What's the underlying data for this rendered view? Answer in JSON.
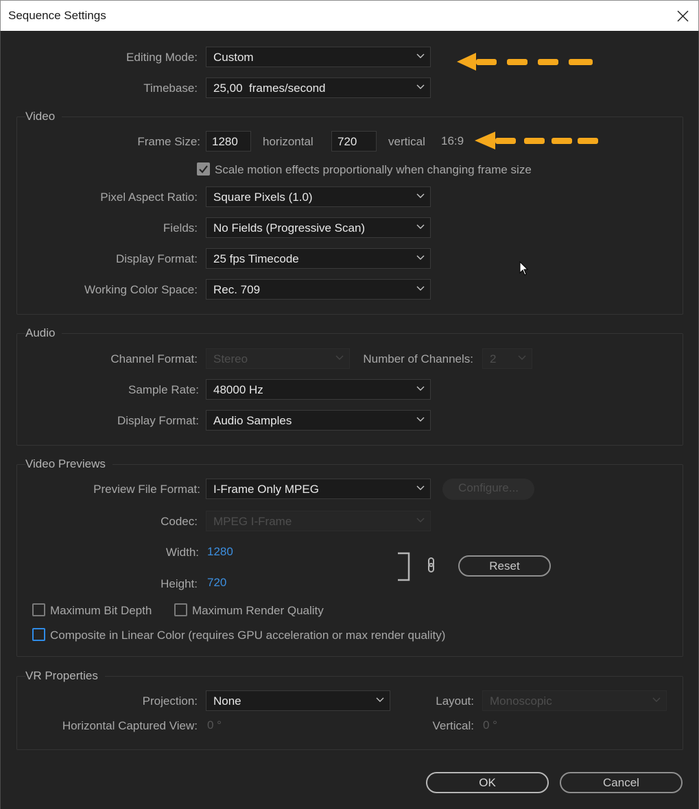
{
  "window": {
    "title": "Sequence Settings"
  },
  "general": {
    "editing_mode": {
      "label": "Editing Mode:",
      "value": "Custom"
    },
    "timebase": {
      "label": "Timebase:",
      "value": "25,00  frames/second"
    }
  },
  "video": {
    "title": "Video",
    "frame_size": {
      "label": "Frame Size:",
      "width": "1280",
      "horizontal_label": "horizontal",
      "height": "720",
      "vertical_label": "vertical",
      "aspect": "16:9"
    },
    "scale_motion": {
      "label": "Scale motion effects proportionally when changing frame size",
      "checked": true
    },
    "pixel_aspect_ratio": {
      "label": "Pixel Aspect Ratio:",
      "value": "Square Pixels (1.0)"
    },
    "fields": {
      "label": "Fields:",
      "value": "No Fields (Progressive Scan)"
    },
    "display_format": {
      "label": "Display Format:",
      "value": "25 fps Timecode"
    },
    "working_color_space": {
      "label": "Working Color Space:",
      "value": "Rec. 709"
    }
  },
  "audio": {
    "title": "Audio",
    "channel_format": {
      "label": "Channel Format:",
      "value": "Stereo"
    },
    "number_of_channels": {
      "label": "Number of Channels:",
      "value": "2"
    },
    "sample_rate": {
      "label": "Sample Rate:",
      "value": "48000 Hz"
    },
    "display_format": {
      "label": "Display Format:",
      "value": "Audio Samples"
    }
  },
  "video_previews": {
    "title": "Video Previews",
    "preview_file_format": {
      "label": "Preview File Format:",
      "value": "I-Frame Only MPEG"
    },
    "configure_label": "Configure...",
    "codec": {
      "label": "Codec:",
      "value": "MPEG I-Frame"
    },
    "width": {
      "label": "Width:",
      "value": "1280"
    },
    "height": {
      "label": "Height:",
      "value": "720"
    },
    "reset_label": "Reset",
    "max_bit_depth": {
      "label": "Maximum Bit Depth",
      "checked": false
    },
    "max_render_quality": {
      "label": "Maximum Render Quality",
      "checked": false
    },
    "composite_linear": {
      "label": "Composite in Linear Color (requires GPU acceleration or max render quality)",
      "checked": false
    }
  },
  "vr": {
    "title": "VR Properties",
    "projection": {
      "label": "Projection:",
      "value": "None"
    },
    "layout": {
      "label": "Layout:",
      "value": "Monoscopic"
    },
    "horizontal_captured_view": {
      "label": "Horizontal Captured View:",
      "value": "0 °"
    },
    "vertical": {
      "label": "Vertical:",
      "value": "0 °"
    }
  },
  "footer": {
    "ok_label": "OK",
    "cancel_label": "Cancel"
  },
  "colors": {
    "annotation_arrow": "#f5a81c",
    "link_value": "#3c8fe0",
    "focus": "#2f8be6"
  }
}
